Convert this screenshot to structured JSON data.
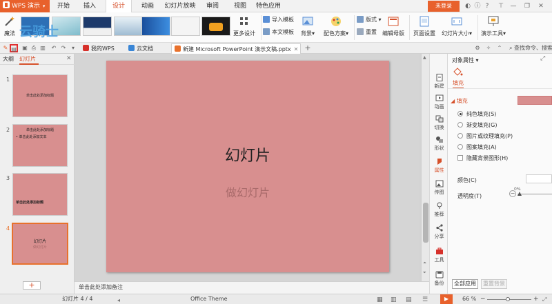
{
  "app": {
    "name": "WPS 演示"
  },
  "menu": {
    "tabs": [
      "开始",
      "插入",
      "设计",
      "动画",
      "幻灯片放映",
      "审阅",
      "视图",
      "特色应用"
    ],
    "active_index": 2,
    "login_label": "未登录"
  },
  "ribbon": {
    "magic_label": "魔法",
    "watermark_text": "云骑士",
    "more_design_label": "更多设计",
    "import_template_label": "导入模板",
    "this_doc_template_label": "本文模板",
    "background_label": "背景",
    "color_scheme_label": "配色方案",
    "layout_label": "版式",
    "reset_label": "重置",
    "edit_master_label": "编辑母版",
    "page_setup_label": "页面设置",
    "slide_size_label": "幻灯片大小",
    "presenter_tools_label": "演示工具"
  },
  "tabstrip": {
    "tabs": [
      {
        "label": "我的WPS",
        "badge_color": "#d6302a"
      },
      {
        "label": "云文档",
        "badge_color": "#3a86d6"
      },
      {
        "label": "新建 Microsoft PowerPoint 演示文稿.pptx",
        "badge_color": "#e8712c"
      }
    ],
    "add_label": "+",
    "search_label": "查找命令、搜索"
  },
  "left_panel": {
    "tabs": [
      "大纲",
      "幻灯片"
    ],
    "active_tab": "幻灯片",
    "slides": [
      {
        "number": "1",
        "title": "单击此处添加标题",
        "subtitle": ""
      },
      {
        "number": "2",
        "title": "单击此处添加标题",
        "subtitle": "• 单击此处添加文本"
      },
      {
        "number": "3",
        "title": "",
        "subtitle": "单击此处添加标题"
      },
      {
        "number": "4",
        "title": "幻灯片",
        "subtitle": "做幻灯片"
      }
    ],
    "selected_index": 3,
    "add_slide_label": "+"
  },
  "slide": {
    "title": "幻灯片",
    "subtitle": "做幻灯片",
    "background_color": "#d88f8f"
  },
  "notes_placeholder": "单击此处添加备注",
  "right_rail": [
    {
      "label": "新建",
      "icon": "new-icon"
    },
    {
      "label": "动画",
      "icon": "animation-icon"
    },
    {
      "label": "切换",
      "icon": "transition-icon"
    },
    {
      "label": "形状",
      "icon": "shape-icon"
    },
    {
      "label": "属性",
      "icon": "property-icon"
    },
    {
      "label": "传图",
      "icon": "upload-image-icon"
    },
    {
      "label": "推荐",
      "icon": "recommend-icon"
    },
    {
      "label": "分享",
      "icon": "share-icon"
    },
    {
      "label": "工具",
      "icon": "tools-icon"
    },
    {
      "label": "备份",
      "icon": "backup-icon"
    }
  ],
  "properties": {
    "header": "对象属性",
    "tab": "填充",
    "section": "填充",
    "options": [
      "纯色填充(S)",
      "渐变填充(G)",
      "图片或纹理填充(P)",
      "图案填充(A)"
    ],
    "selected_option": 0,
    "hide_bg_label": "隐藏背景图形(H)",
    "color_label": "颜色(C)",
    "transparency_label": "透明度(T)",
    "transparency_value": "0%",
    "apply_all_label": "全部应用",
    "reset_bg_label": "重置背景"
  },
  "status": {
    "slide_counter": "幻灯片 4 / 4",
    "theme": "Office Theme",
    "zoom": "66 %"
  },
  "colors": {
    "accent": "#e8612c",
    "slide_fill": "#d88f8f"
  }
}
